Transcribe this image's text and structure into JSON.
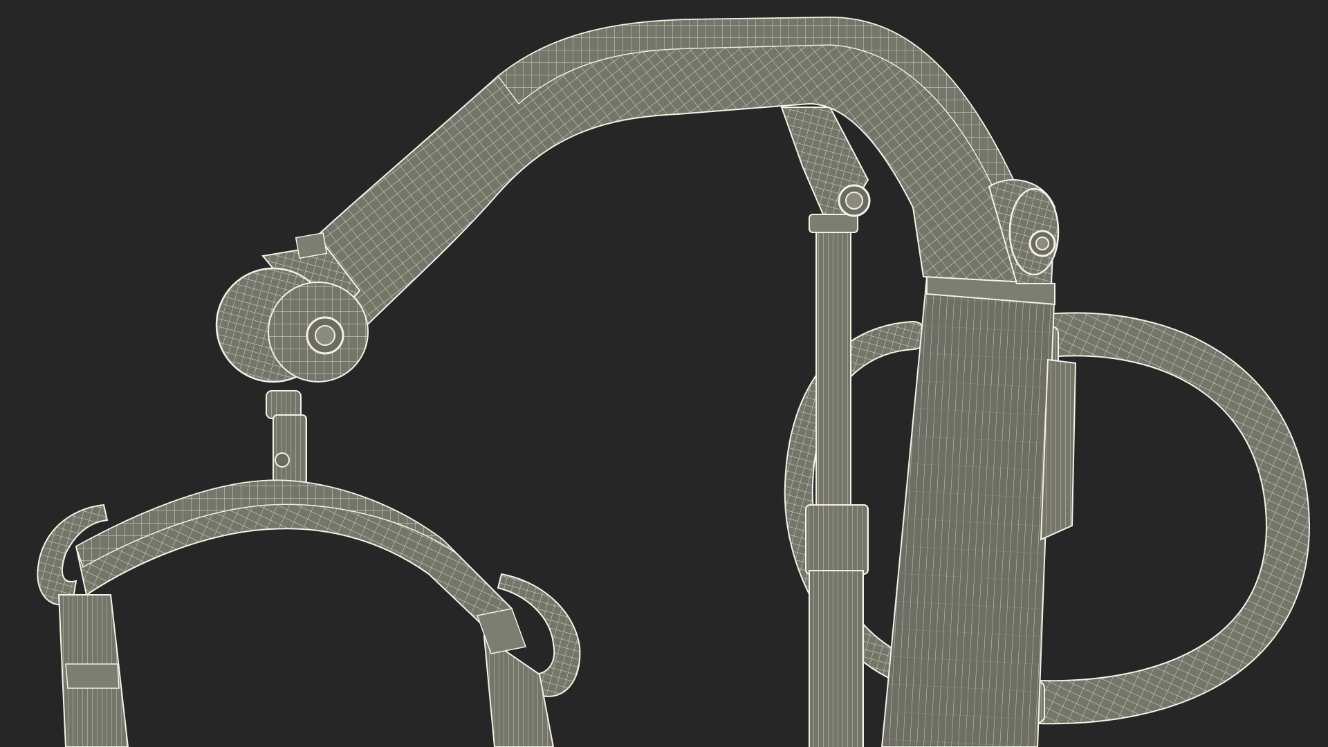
{
  "scene": {
    "background_color": "#262626",
    "mesh_fill_color": "#75766a",
    "mesh_fill_dark_color": "#5f6056",
    "wire_color": "#f2f2e6",
    "components": [
      "boom-arm",
      "spreader-bar",
      "actuator",
      "mast",
      "push-handle",
      "sling-hooks",
      "pivot-joints"
    ]
  }
}
